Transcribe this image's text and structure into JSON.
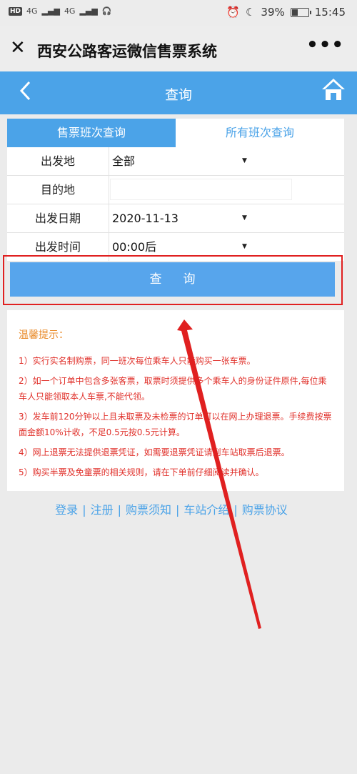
{
  "status": {
    "signal_left": "4G",
    "signal_right": "4G",
    "battery": "39%",
    "battery_level": 0.39,
    "time": "15:45"
  },
  "wechat": {
    "title": "西安公路客运微信售票系统",
    "close_icon": "close-icon",
    "more_icon": "more-icon"
  },
  "header": {
    "title": "查询",
    "back_icon": "chevron-left-icon",
    "home_icon": "home-icon"
  },
  "tabs": [
    {
      "label": "售票班次查询",
      "active": true
    },
    {
      "label": "所有班次查询",
      "active": false
    }
  ],
  "form": {
    "departure": {
      "label": "出发地",
      "value": "全部"
    },
    "destination": {
      "label": "目的地",
      "value": ""
    },
    "date": {
      "label": "出发日期",
      "value": "2020-11-13"
    },
    "time": {
      "label": "出发时间",
      "value": "00:00后"
    }
  },
  "search_button": "查询",
  "tips": {
    "title": "温馨提示：",
    "items": [
      "1）实行实名制购票，同一班次每位乘车人只能购买一张车票。",
      "2）如一个订单中包含多张客票，取票时须提供多个乘车人的身份证件原件,每位乘车人只能领取本人车票,不能代领。",
      "3）发车前120分钟以上且未取票及未检票的订单可以在网上办理退票。手续费按票面金额10%计收，不足0.5元按0.5元计算。",
      "4）网上退票无法提供退票凭证，如需要退票凭证请到车站取票后退票。",
      "5）购买半票及免童票的相关规则，请在下单前仔细阅读并确认。"
    ]
  },
  "footer": {
    "links": [
      "登录",
      "注册",
      "购票须知",
      "车站介绍",
      "购票协议"
    ],
    "separator": "|"
  },
  "colors": {
    "accent": "#4ba3e8",
    "highlight_box": "#e02020",
    "tips_title": "#e98b2a",
    "tips_text": "#e0302a"
  }
}
